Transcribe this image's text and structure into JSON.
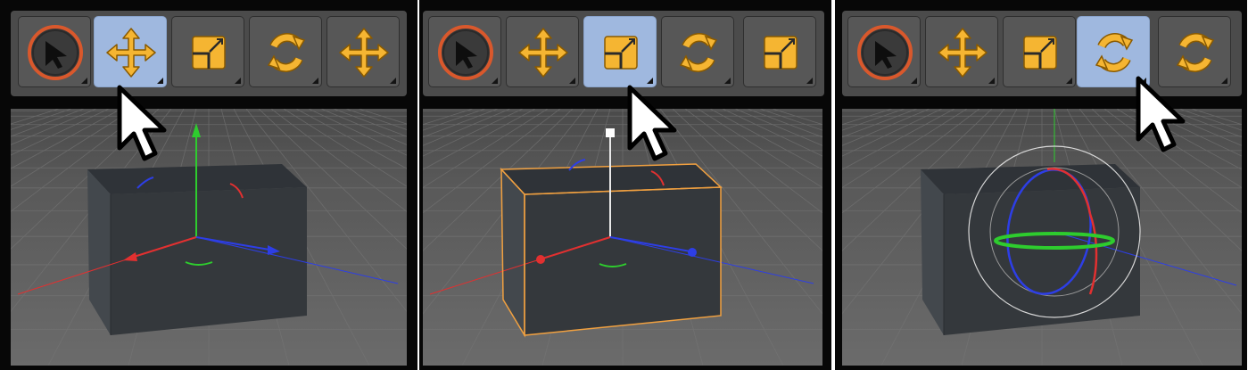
{
  "panels": [
    {
      "id": "move",
      "active_tool_index": 1,
      "toolbar": [
        {
          "tool": "select-cursor-icon"
        },
        {
          "tool": "move-arrows-icon"
        },
        {
          "tool": "scale-box-icon"
        },
        {
          "tool": "rotate-circle-icon"
        },
        {
          "tool": "move-arrows-icon"
        }
      ],
      "manipulator": "move"
    },
    {
      "id": "scale",
      "active_tool_index": 2,
      "toolbar": [
        {
          "tool": "select-cursor-icon"
        },
        {
          "tool": "move-arrows-icon"
        },
        {
          "tool": "scale-box-icon"
        },
        {
          "tool": "rotate-circle-icon"
        },
        {
          "tool": "scale-box-icon"
        }
      ],
      "manipulator": "scale"
    },
    {
      "id": "rotate",
      "active_tool_index": 3,
      "toolbar": [
        {
          "tool": "select-cursor-icon"
        },
        {
          "tool": "move-arrows-icon"
        },
        {
          "tool": "scale-box-icon"
        },
        {
          "tool": "rotate-circle-icon"
        },
        {
          "tool": "rotate-circle-icon"
        }
      ],
      "manipulator": "rotate"
    }
  ],
  "colors": {
    "toolbar_bg": "#4b4b4b",
    "button_bg": "#575757",
    "button_active": "#9fb8df",
    "icon_yellow": "#f5b532",
    "select_ring": "#d9582c",
    "viewport_bg": "#5f5f5f",
    "cube_front": "#43484d",
    "cube_side": "#34383c",
    "cube_top": "#2f3338",
    "axis_x": "#e23030",
    "axis_y": "#2ecc2e",
    "axis_z": "#2d3ee6",
    "selection_outline": "#f0a040"
  }
}
